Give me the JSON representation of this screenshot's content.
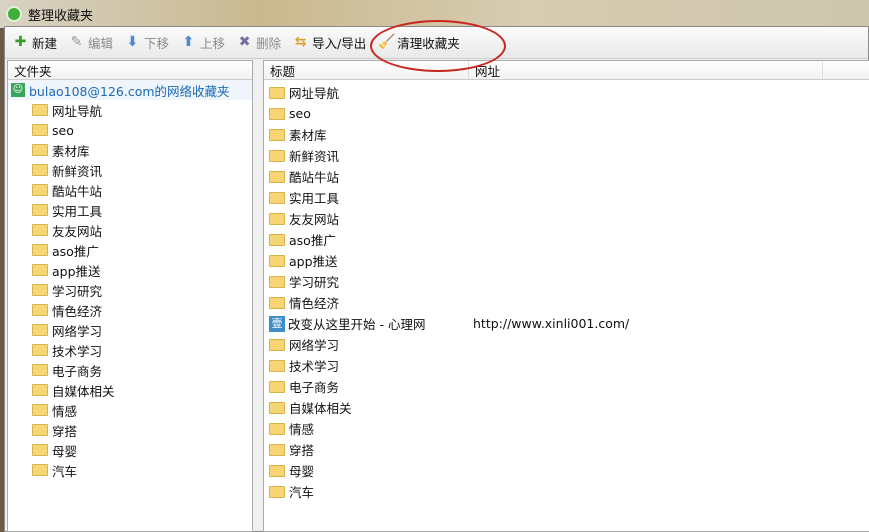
{
  "window": {
    "title": "整理收藏夹"
  },
  "toolbar": [
    {
      "label": "新建",
      "icon": "plus-icon",
      "enabled": true,
      "color": "#3a9a2a"
    },
    {
      "label": "编辑",
      "icon": "pencil-icon",
      "enabled": false,
      "color": "#999999"
    },
    {
      "label": "下移",
      "icon": "arrow-down-icon",
      "enabled": false,
      "color": "#4a8ad8"
    },
    {
      "label": "上移",
      "icon": "arrow-up-icon",
      "enabled": false,
      "color": "#4a8ad8"
    },
    {
      "label": "删除",
      "icon": "x-icon",
      "enabled": false,
      "color": "#7a6aa8"
    },
    {
      "label": "导入/导出",
      "icon": "import-export-icon",
      "enabled": true,
      "color": "#e0a030"
    },
    {
      "label": "清理收藏夹",
      "icon": "broom-icon",
      "enabled": true,
      "color": "#8a5a2a"
    }
  ],
  "left": {
    "header": "文件夹",
    "root": "bulao108@126.com的网络收藏夹",
    "folders": [
      "网址导航",
      "seo",
      "素材库",
      "新鲜资讯",
      "酷站牛站",
      "实用工具",
      "友友网站",
      "aso推广",
      "app推送",
      "学习研究",
      "情色经济",
      "网络学习",
      "技术学习",
      "电子商务",
      "自媒体相关",
      "情感",
      "穿搭",
      "母婴",
      "汽车"
    ]
  },
  "right": {
    "columns": [
      "标题",
      "网址"
    ],
    "rows": [
      {
        "type": "folder",
        "title": "网址导航",
        "url": ""
      },
      {
        "type": "folder",
        "title": "seo",
        "url": ""
      },
      {
        "type": "folder",
        "title": "素材库",
        "url": ""
      },
      {
        "type": "folder",
        "title": "新鲜资讯",
        "url": ""
      },
      {
        "type": "folder",
        "title": "酷站牛站",
        "url": ""
      },
      {
        "type": "folder",
        "title": "实用工具",
        "url": ""
      },
      {
        "type": "folder",
        "title": "友友网站",
        "url": ""
      },
      {
        "type": "folder",
        "title": "aso推广",
        "url": ""
      },
      {
        "type": "folder",
        "title": "app推送",
        "url": ""
      },
      {
        "type": "folder",
        "title": "学习研究",
        "url": ""
      },
      {
        "type": "folder",
        "title": "情色经济",
        "url": ""
      },
      {
        "type": "link",
        "title": "改变从这里开始 - 心理网",
        "url": "http://www.xinli001.com/",
        "icon_text": "壹"
      },
      {
        "type": "folder",
        "title": "网络学习",
        "url": ""
      },
      {
        "type": "folder",
        "title": "技术学习",
        "url": ""
      },
      {
        "type": "folder",
        "title": "电子商务",
        "url": ""
      },
      {
        "type": "folder",
        "title": "自媒体相关",
        "url": ""
      },
      {
        "type": "folder",
        "title": "情感",
        "url": ""
      },
      {
        "type": "folder",
        "title": "穿搭",
        "url": ""
      },
      {
        "type": "folder",
        "title": "母婴",
        "url": ""
      },
      {
        "type": "folder",
        "title": "汽车",
        "url": ""
      }
    ]
  }
}
